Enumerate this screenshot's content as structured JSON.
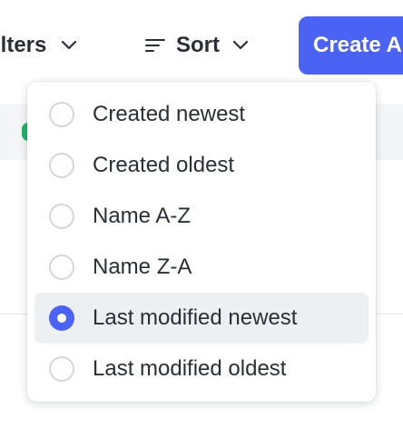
{
  "toolbar": {
    "filters_label": "ilters",
    "sort_label": "Sort",
    "create_label": "Create A"
  },
  "sort_menu": {
    "options": [
      {
        "label": "Created newest",
        "selected": false
      },
      {
        "label": "Created oldest",
        "selected": false
      },
      {
        "label": "Name A-Z",
        "selected": false
      },
      {
        "label": "Name Z-A",
        "selected": false
      },
      {
        "label": "Last modified newest",
        "selected": true
      },
      {
        "label": "Last modified oldest",
        "selected": false
      }
    ]
  },
  "colors": {
    "accent": "#4a63f5",
    "status_green": "#22b36a",
    "selected_row_bg": "#edf0f3"
  },
  "icons": {
    "sort": "sort-lines-icon",
    "chevron": "chevron-down-icon",
    "radio": "radio-icon"
  }
}
